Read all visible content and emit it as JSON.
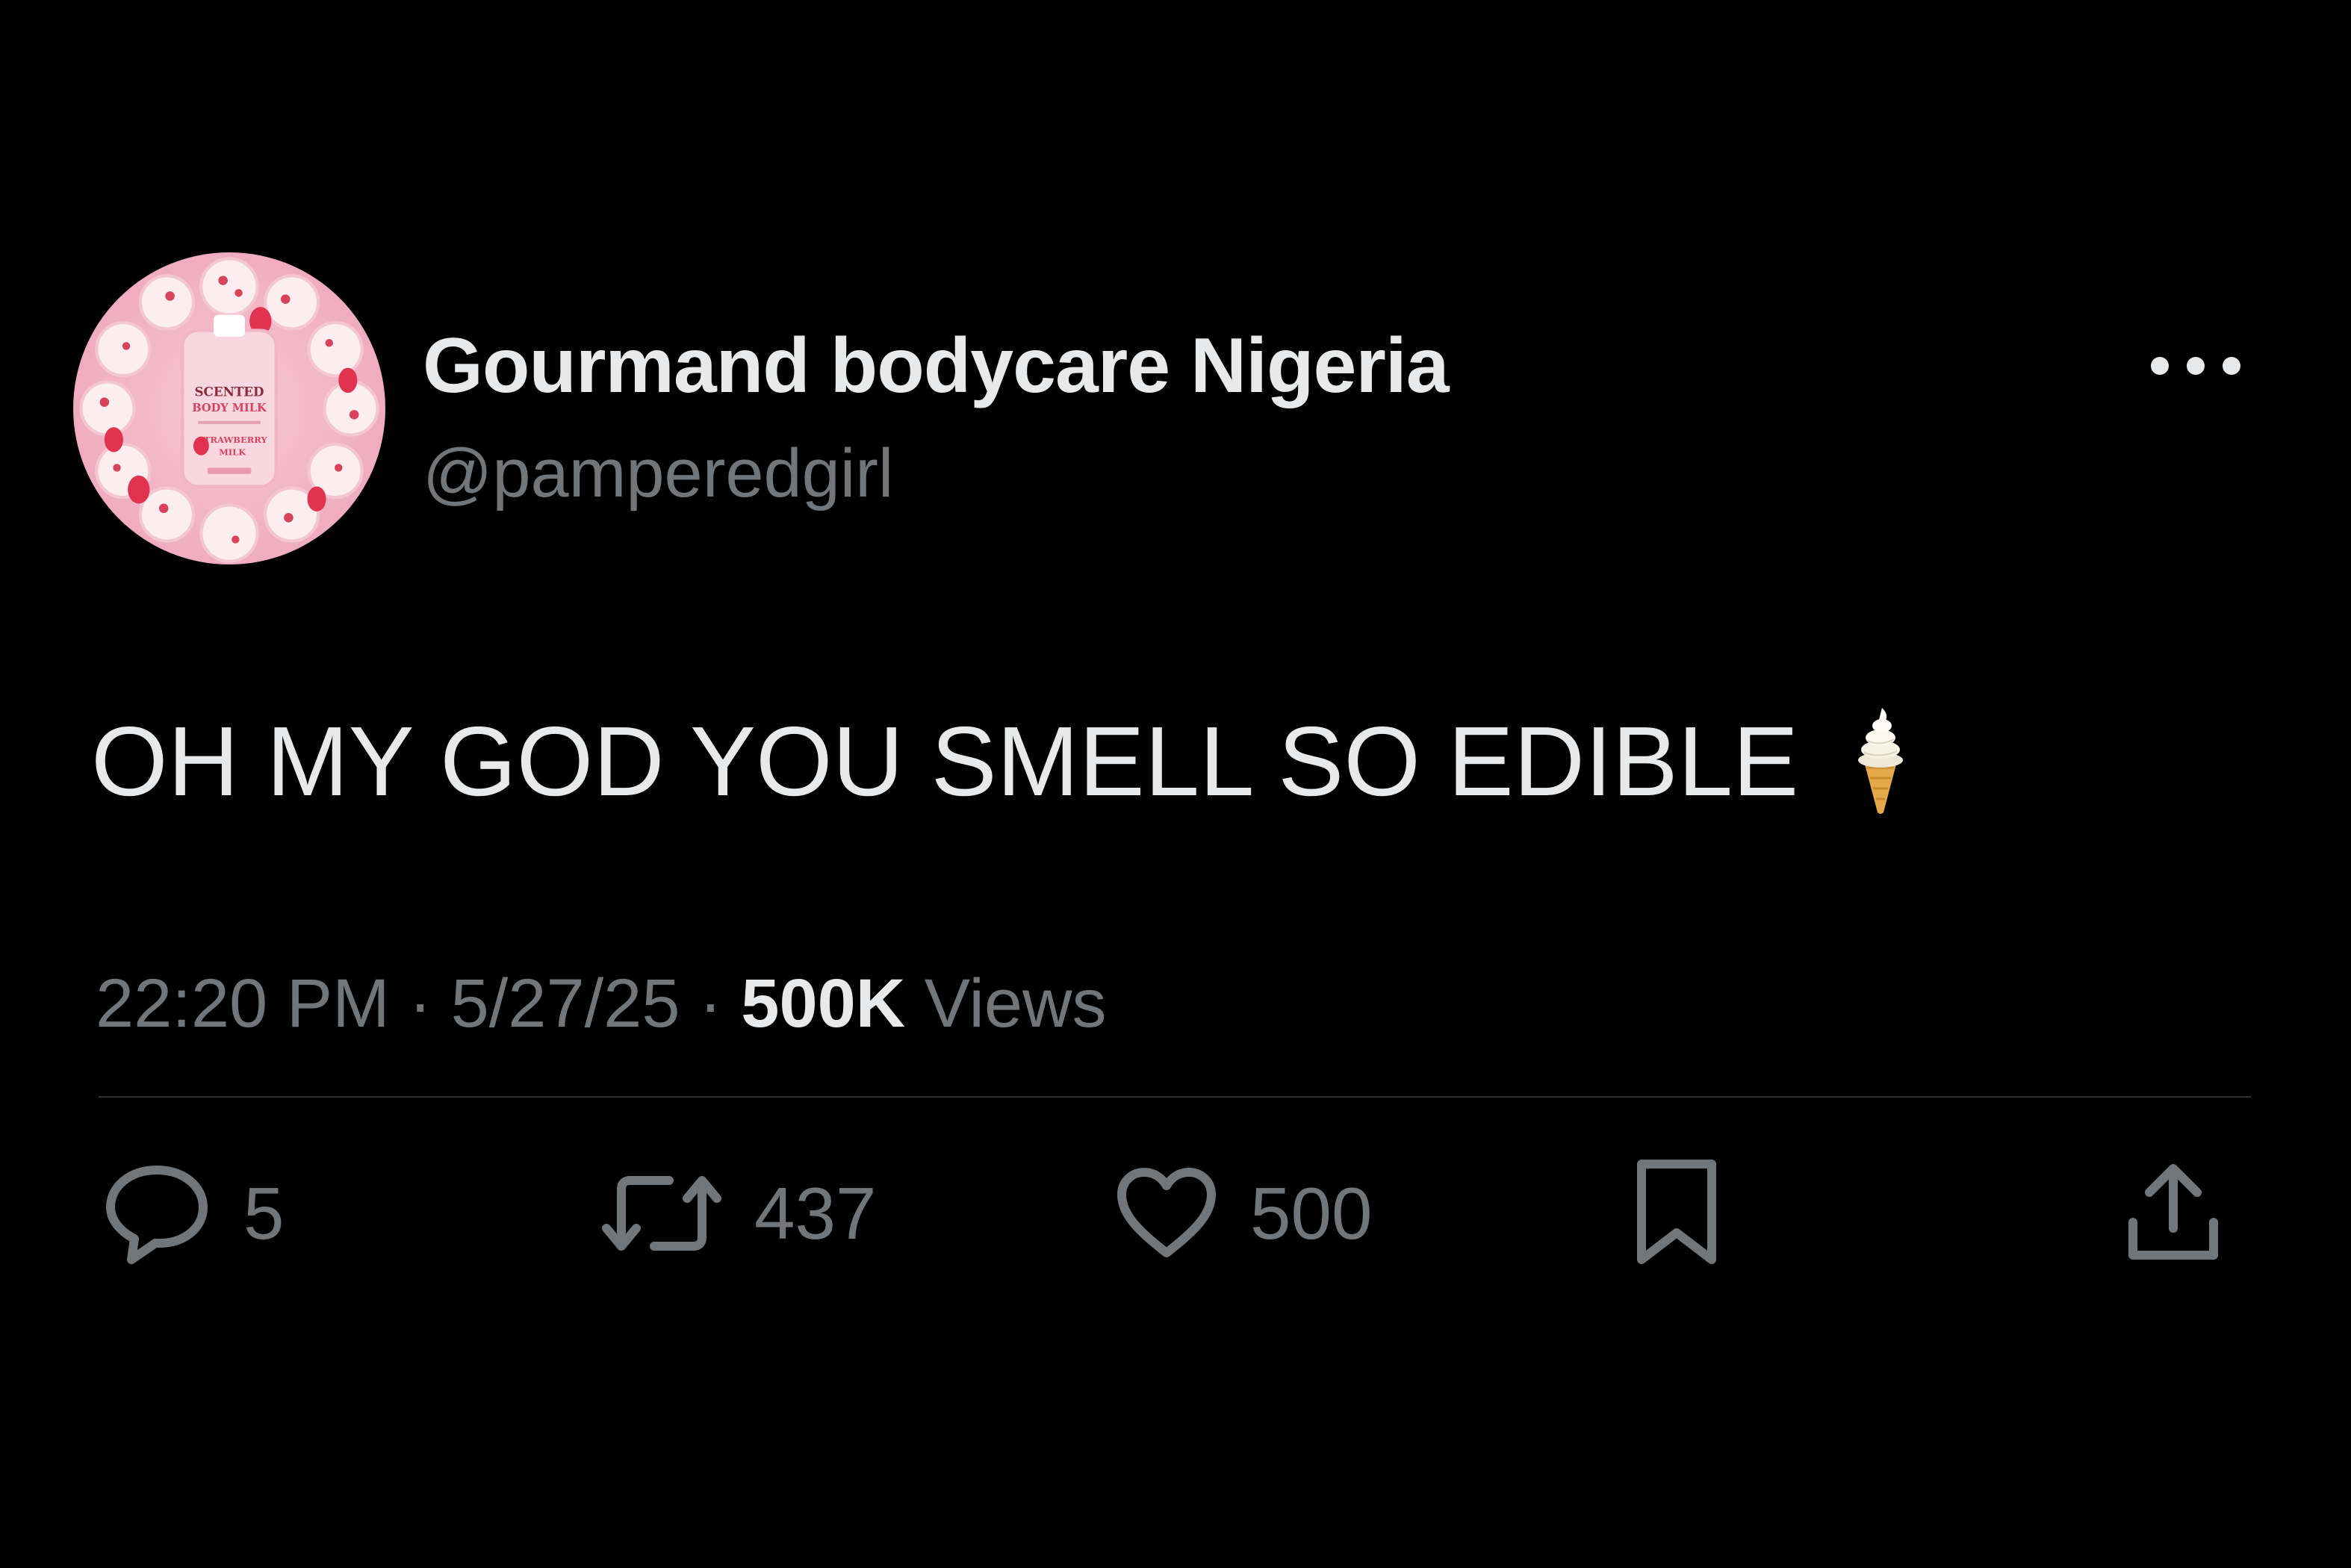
{
  "author": {
    "display_name": "Gourmand bodycare Nigeria",
    "handle": "@pamperedgirl",
    "avatar_icon": "scented-body-milk-avatar",
    "avatar_text": [
      "SCENTED",
      "BODY MILK",
      "STRAWBERRY",
      "MILK"
    ]
  },
  "tweet": {
    "text": "OH MY GOD YOU SMELL SO EDIBLE",
    "emoji_icon": "soft-ice-cream-icon"
  },
  "meta": {
    "time": "22:20 PM",
    "separator_1": " · ",
    "date": "5/27/25",
    "separator_2": " · ",
    "views_count": "500K",
    "views_label": " Views"
  },
  "actions": {
    "reply_count": "5",
    "retweet_count": "437",
    "like_count": "500"
  },
  "colors": {
    "background": "#000000",
    "primary_text": "#e7e9ea",
    "secondary_text": "#71767b",
    "divider": "#2f3336"
  }
}
